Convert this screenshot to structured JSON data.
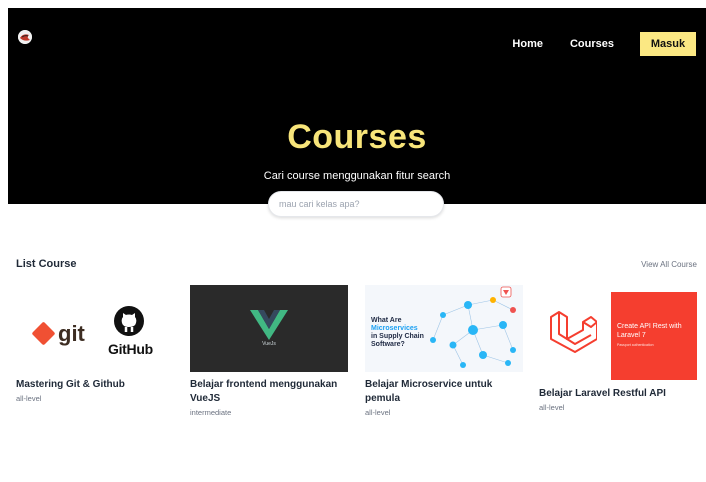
{
  "nav": {
    "home": "Home",
    "courses": "Courses",
    "login": "Masuk"
  },
  "hero": {
    "title": "Courses",
    "subtitle": "Cari course menggunakan fitur search"
  },
  "search": {
    "placeholder": "mau cari kelas apa?"
  },
  "list": {
    "title": "List Course",
    "view_all": "View All Course"
  },
  "courses": [
    {
      "title": "Mastering Git & Github",
      "level": "all-level",
      "thumb_text": [
        "git",
        "GitHub"
      ]
    },
    {
      "title": "Belajar frontend menggunakan VueJS",
      "level": "intermediate",
      "thumb_text": [
        "VueJs"
      ]
    },
    {
      "title": "Belajar Microservice untuk pemula",
      "level": "all-level",
      "thumb_text": [
        "What Are",
        "Microservices",
        "in Supply Chain",
        "Software?"
      ]
    },
    {
      "title": "Belajar Laravel Restful API",
      "level": "all-level",
      "thumb_text": [
        "Create API Rest with Laravel 7",
        "Passport authentication"
      ]
    }
  ],
  "colors": {
    "hero_bg": "#000000",
    "accent_yellow": "#fbe883",
    "title_yellow": "#f8e57a",
    "laravel_red": "#f53e2f",
    "vue_green": "#41b883"
  },
  "icons": {
    "logo": "brand-logo-icon",
    "github": "github-icon",
    "vue": "vue-icon",
    "laravel": "laravel-icon"
  }
}
